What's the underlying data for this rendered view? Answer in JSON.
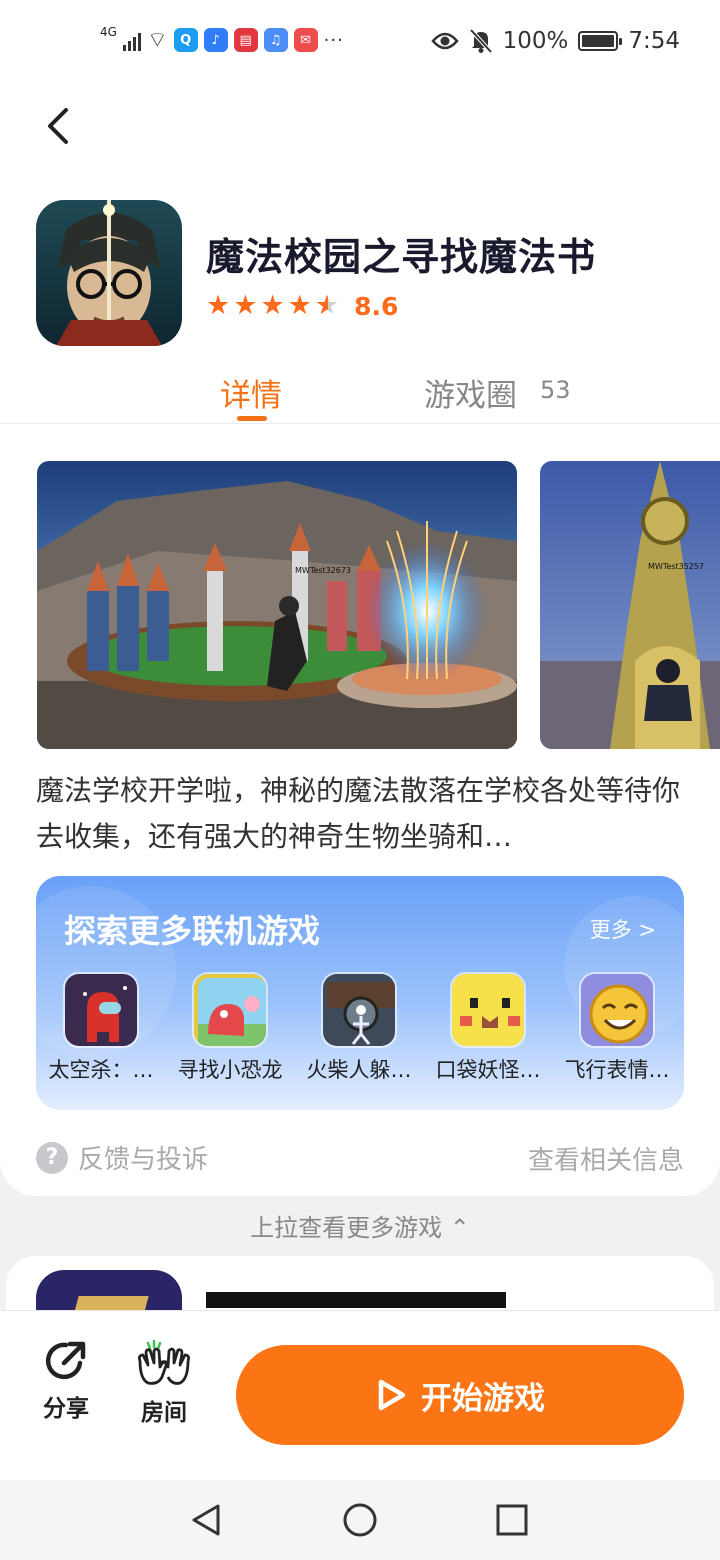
{
  "status_bar": {
    "network": "4G",
    "battery": "100%",
    "time": "7:54",
    "battery_level": 1.0,
    "apps": [
      {
        "name": "search-app-icon",
        "color": "#1e9cf0",
        "glyph": "Q"
      },
      {
        "name": "bulb-app-icon",
        "color": "#2f7df6",
        "glyph": "♪"
      },
      {
        "name": "book-app-icon",
        "color": "#e0383e",
        "glyph": "▤"
      },
      {
        "name": "music-app-icon",
        "color": "#4d8df7",
        "glyph": "♫"
      },
      {
        "name": "huawei-app-icon",
        "color": "#ef4d4d",
        "glyph": "✉"
      }
    ]
  },
  "game": {
    "title": "魔法校园之寻找魔法书",
    "rating": "8.6",
    "rating_value": 8.6,
    "rating_stars": 4.5
  },
  "tabs": {
    "detail": "详情",
    "circle": "游戏圈",
    "circle_count": "53"
  },
  "screenshot_labels": [
    "MWTest32673",
    "MWTest35257"
  ],
  "description": "魔法学校开学啦，神秘的魔法散落在学校各处等待你去收集，还有强大的神奇生物坐骑和…",
  "explore": {
    "title": "探索更多联机游戏",
    "more": "更多 >",
    "games": [
      {
        "label": "太空杀：…",
        "icon": "among-us-icon"
      },
      {
        "label": "寻找小恐龙",
        "icon": "dino-icon"
      },
      {
        "label": "火柴人躲…",
        "icon": "stickman-icon"
      },
      {
        "label": "口袋妖怪…",
        "icon": "pokemon-icon"
      },
      {
        "label": "飞行表情…",
        "icon": "emoji-icon"
      }
    ]
  },
  "feedback": {
    "label": "反馈与投诉",
    "related": "查看相关信息"
  },
  "pull_up": "上拉查看更多游戏 ⌃",
  "actions": {
    "share": "分享",
    "room": "房间",
    "start": "开始游戏"
  },
  "colors": {
    "accent": "#fb7514",
    "star": "#ff6b1a",
    "explore_top": "#6aa1f7"
  }
}
